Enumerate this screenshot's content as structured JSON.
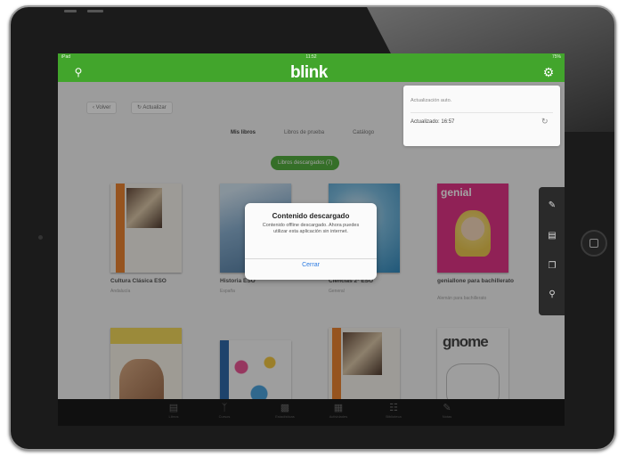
{
  "app": {
    "logo": "blink",
    "status_left": "iPad",
    "status_center": "11:52",
    "status_right": "75%"
  },
  "toolbar": {
    "back_label": "‹ Volver",
    "refresh_label": "↻ Actualizar"
  },
  "filters": [
    "Mis libros",
    "Libros de prueba",
    "Catálogo"
  ],
  "offline_pill": "Libros descargados (7)",
  "books": [
    {
      "title": "Cultura Clásica ESO",
      "subtitle": "Andalucía"
    },
    {
      "title": "Historia ESO",
      "subtitle": "España"
    },
    {
      "title": "Ciencias 2º ESO",
      "subtitle": "General"
    },
    {
      "title": "geniallone para bachillerato",
      "subtitle": "Alemán para bachillerato",
      "cover_text": "genial"
    },
    {
      "title": "",
      "subtitle": ""
    },
    {
      "title": "",
      "subtitle": ""
    },
    {
      "title": "",
      "subtitle": ""
    },
    {
      "title": "",
      "subtitle": "",
      "cover_text": "gnome"
    }
  ],
  "settings_popover": {
    "header": "Actualización auto.",
    "row": "Actualizado: 16:57"
  },
  "dialog": {
    "title": "Contenido descargado",
    "message": "Contenido offline descargado. Ahora puedes utilizar esta aplicación sin internet.",
    "button": "Cerrar"
  },
  "side_toolbar": [
    "pencil-icon",
    "layers-icon",
    "copy-icon",
    "pin-icon"
  ],
  "dock_items": [
    "Libros",
    "Cursos",
    "Estadísticas",
    "Actividades",
    "Biblioteca",
    "Notas"
  ],
  "colors": {
    "brand_green": "#42a52c",
    "dialog_button": "#2a7ae2"
  }
}
